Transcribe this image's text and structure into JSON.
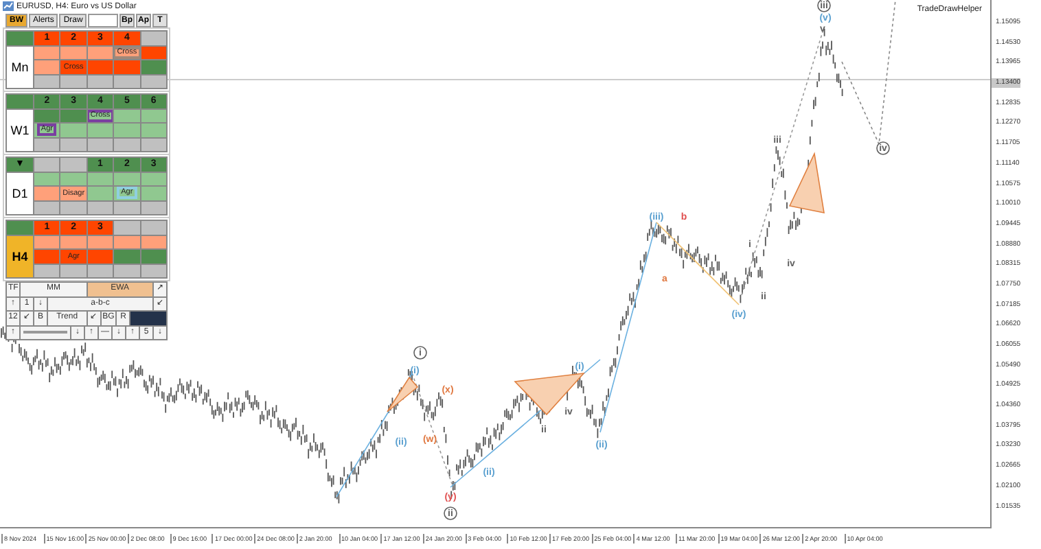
{
  "window": {
    "title": "EURUSD, H4: Euro vs US Dollar"
  },
  "indicator": {
    "name": "TradeDrawHelper"
  },
  "panel": {
    "tabs": [
      {
        "label": "BW",
        "selected": true
      },
      {
        "label": "Alerts",
        "selected": false
      },
      {
        "label": "Draw",
        "selected": false
      }
    ],
    "toggles": [
      "Bp",
      "Ap",
      "T"
    ],
    "timeframes": [
      {
        "label": "Mn",
        "color": "#ffffff",
        "header": [
          {
            "color": "#4f8f4f"
          },
          {
            "color": "#ff4500",
            "text": "1"
          },
          {
            "color": "#ff4500",
            "text": "2"
          },
          {
            "color": "#ff4500",
            "text": "3"
          },
          {
            "color": "#ff4500",
            "text": "4"
          },
          {
            "color": "#c0c0c0"
          }
        ],
        "rows": [
          [
            {
              "color": "#ffa07a"
            },
            {
              "color": "#ffa07a"
            },
            {
              "color": "#ffa07a"
            },
            {
              "color": "#ffa07a",
              "tag": {
                "text": "Cross",
                "color": "#a08878"
              }
            },
            {
              "color": "#ff4500"
            }
          ],
          [
            {
              "color": "#ffa07a"
            },
            {
              "color": "#ff4500",
              "text": "Cross"
            },
            {
              "color": "#ff4500"
            },
            {
              "color": "#ff4500"
            },
            {
              "color": "#4f8f4f"
            }
          ],
          [
            {
              "color": "#c0c0c0"
            },
            {
              "color": "#c0c0c0"
            },
            {
              "color": "#c0c0c0"
            },
            {
              "color": "#c0c0c0"
            },
            {
              "color": "#c0c0c0"
            }
          ]
        ]
      },
      {
        "label": "W1",
        "color": "#ffffff",
        "header": [
          {
            "color": "#4f8f4f"
          },
          {
            "color": "#4f8f4f",
            "text": "2"
          },
          {
            "color": "#4f8f4f",
            "text": "3"
          },
          {
            "color": "#4f8f4f",
            "text": "4"
          },
          {
            "color": "#4f8f4f",
            "text": "5"
          },
          {
            "color": "#4f8f4f",
            "text": "6"
          }
        ],
        "rows": [
          [
            {
              "color": "#4f8f4f"
            },
            {
              "color": "#4f8f4f"
            },
            {
              "color": "#90c890",
              "tag": {
                "text": "Cross",
                "color": "#7a3fa0"
              }
            },
            {
              "color": "#90c890"
            },
            {
              "color": "#90c890"
            }
          ],
          [
            {
              "color": "#90c890",
              "tag": {
                "text": "Agr",
                "color": "#7a3fa0"
              }
            },
            {
              "color": "#90c890"
            },
            {
              "color": "#90c890"
            },
            {
              "color": "#90c890"
            },
            {
              "color": "#90c890"
            }
          ],
          [
            {
              "color": "#c0c0c0"
            },
            {
              "color": "#c0c0c0"
            },
            {
              "color": "#c0c0c0"
            },
            {
              "color": "#c0c0c0"
            },
            {
              "color": "#c0c0c0"
            }
          ]
        ]
      },
      {
        "label": "D1",
        "color": "#ffffff",
        "header": [
          {
            "color": "#4f8f4f",
            "text": "▼"
          },
          {
            "color": "#c0c0c0"
          },
          {
            "color": "#c0c0c0"
          },
          {
            "color": "#4f8f4f",
            "text": "1"
          },
          {
            "color": "#4f8f4f",
            "text": "2"
          },
          {
            "color": "#4f8f4f",
            "text": "3"
          }
        ],
        "rows": [
          [
            {
              "color": "#90c890"
            },
            {
              "color": "#90c890"
            },
            {
              "color": "#90c890"
            },
            {
              "color": "#90c890"
            },
            {
              "color": "#90c890"
            }
          ],
          [
            {
              "color": "#ffa07a"
            },
            {
              "color": "#ffa07a",
              "text": "Disagr"
            },
            {
              "color": "#90c890"
            },
            {
              "color": "#90c890",
              "tag": {
                "text": "Agr",
                "color": "#8fd0e0"
              }
            },
            {
              "color": "#90c890"
            }
          ],
          [
            {
              "color": "#c0c0c0"
            },
            {
              "color": "#c0c0c0"
            },
            {
              "color": "#c0c0c0"
            },
            {
              "color": "#c0c0c0"
            },
            {
              "color": "#c0c0c0"
            }
          ]
        ]
      },
      {
        "label": "H4",
        "color": "#f0b428",
        "header": [
          {
            "color": "#4f8f4f"
          },
          {
            "color": "#ff4500",
            "text": "1"
          },
          {
            "color": "#ff4500",
            "text": "2"
          },
          {
            "color": "#ff4500",
            "text": "3"
          },
          {
            "color": "#c0c0c0"
          },
          {
            "color": "#c0c0c0"
          }
        ],
        "rows": [
          [
            {
              "color": "#ffa07a"
            },
            {
              "color": "#ffa07a"
            },
            {
              "color": "#ffa07a"
            },
            {
              "color": "#ffa07a"
            },
            {
              "color": "#ffa07a"
            }
          ],
          [
            {
              "color": "#ff4500"
            },
            {
              "color": "#ff4500",
              "text": "Agr"
            },
            {
              "color": "#ff4500"
            },
            {
              "color": "#4f8f4f"
            },
            {
              "color": "#4f8f4f"
            }
          ],
          [
            {
              "color": "#c0c0c0"
            },
            {
              "color": "#c0c0c0"
            },
            {
              "color": "#c0c0c0"
            },
            {
              "color": "#c0c0c0"
            },
            {
              "color": "#c0c0c0"
            }
          ]
        ]
      }
    ],
    "tf_label": "TF",
    "modes": [
      {
        "label": "MM",
        "selected": false
      },
      {
        "label": "EWA",
        "selected": true
      }
    ],
    "corner": "↗",
    "tools": [
      [
        {
          "kind": "key",
          "text": "↑"
        },
        {
          "kind": "key",
          "text": "1"
        },
        {
          "kind": "key",
          "text": "↓"
        },
        {
          "kind": "wide",
          "text": "a-b-c"
        },
        {
          "kind": "key",
          "text": "↙"
        }
      ],
      [
        {
          "kind": "key",
          "text": "12"
        },
        {
          "kind": "key",
          "text": "↙"
        },
        {
          "kind": "key",
          "text": "B"
        },
        {
          "kind": "wide",
          "text": "Trend"
        },
        {
          "kind": "key",
          "text": "↙"
        },
        {
          "kind": "key",
          "text": "BG"
        },
        {
          "kind": "key",
          "text": "R"
        },
        {
          "kind": "swatch",
          "color": "#24324a"
        }
      ],
      [
        {
          "kind": "key",
          "text": "↑"
        },
        {
          "kind": "bar"
        },
        {
          "kind": "key",
          "text": "↓"
        },
        {
          "kind": "key",
          "text": "↑"
        },
        {
          "kind": "key",
          "text": "—"
        },
        {
          "kind": "key",
          "text": "↓"
        },
        {
          "kind": "key",
          "text": "↑"
        },
        {
          "kind": "key",
          "text": "5"
        },
        {
          "kind": "key",
          "text": "↓"
        }
      ]
    ]
  },
  "waves": [
    {
      "text": "i",
      "kind": "circled",
      "color": "#606060"
    },
    {
      "text": "(i)",
      "kind": "plain",
      "color": "#5aa0d0"
    },
    {
      "text": "(ii)",
      "kind": "plain",
      "color": "#5aa0d0"
    },
    {
      "text": "(x)",
      "kind": "plain",
      "color": "#e07840"
    },
    {
      "text": "(w)",
      "kind": "plain",
      "color": "#e07840"
    },
    {
      "text": "(y)",
      "kind": "plain",
      "color": "#e05050"
    },
    {
      "text": "ii",
      "kind": "circled",
      "color": "#606060"
    },
    {
      "text": "(ii)",
      "kind": "plain",
      "color": "#5aa0d0"
    },
    {
      "text": "ii",
      "kind": "plain",
      "color": "#606060"
    },
    {
      "text": "(i)",
      "kind": "plain",
      "color": "#5aa0d0"
    },
    {
      "text": "iv",
      "kind": "plain",
      "color": "#606060"
    },
    {
      "text": "(ii)",
      "kind": "plain",
      "color": "#5aa0d0"
    },
    {
      "text": "(iii)",
      "kind": "plain",
      "color": "#5aa0d0"
    },
    {
      "text": "a",
      "kind": "plain",
      "color": "#e07840"
    },
    {
      "text": "b",
      "kind": "plain",
      "color": "#e05050"
    },
    {
      "text": "(iv)",
      "kind": "plain",
      "color": "#5aa0d0"
    },
    {
      "text": "i",
      "kind": "plain",
      "color": "#606060"
    },
    {
      "text": "ii",
      "kind": "plain",
      "color": "#606060"
    },
    {
      "text": "iii",
      "kind": "plain",
      "color": "#606060"
    },
    {
      "text": "iv",
      "kind": "plain",
      "color": "#606060"
    },
    {
      "text": "iii",
      "kind": "circled",
      "color": "#606060"
    },
    {
      "text": "(v)",
      "kind": "plain",
      "color": "#5aa0d0"
    },
    {
      "text": "v",
      "kind": "plain",
      "color": "#606060"
    },
    {
      "text": "iv",
      "kind": "circled",
      "color": "#606060"
    }
  ],
  "price_axis": {
    "labels": [
      "1.15095",
      "1.14530",
      "1.13965",
      "1.13400",
      "1.12835",
      "1.12270",
      "1.11705",
      "1.11140",
      "1.10575",
      "1.10010",
      "1.09445",
      "1.08880",
      "1.08315",
      "1.07750",
      "1.07185",
      "1.06620",
      "1.06055",
      "1.05490",
      "1.04925",
      "1.04360",
      "1.03795",
      "1.03230",
      "1.02665",
      "1.02100",
      "1.01535"
    ]
  },
  "time_axis": {
    "labels": [
      "8 Nov 2024",
      "15 Nov 16:00",
      "25 Nov 00:00",
      "2 Dec 08:00",
      "9 Dec 16:00",
      "17 Dec 00:00",
      "24 Dec 08:00",
      "2 Jan 20:00",
      "10 Jan 04:00",
      "17 Jan 12:00",
      "24 Jan 20:00",
      "3 Feb 04:00",
      "10 Feb 12:00",
      "17 Feb 20:00",
      "25 Feb 04:00",
      "4 Mar 12:00",
      "11 Mar 20:00",
      "19 Mar 04:00",
      "26 Mar 12:00",
      "2 Apr 20:00",
      "10 Apr 04:00"
    ]
  }
}
